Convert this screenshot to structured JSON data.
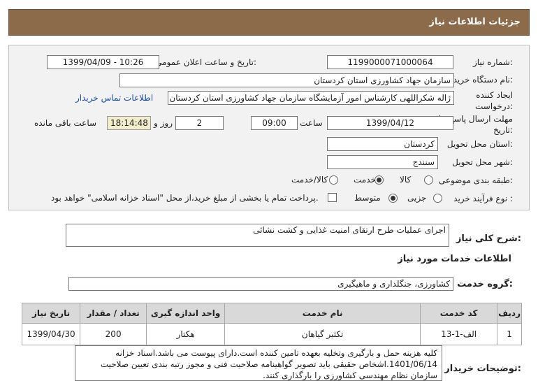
{
  "header": {
    "title": "جزئیات اطلاعات نیاز"
  },
  "form": {
    "need_number_label": "شماره نیاز:",
    "need_number": "1199000071000064",
    "announce_label": "تاریخ و ساعت اعلان عمومی:",
    "announce_value": "1399/04/09 - 10:26",
    "buyer_org_label": "نام دستگاه خریدار:",
    "buyer_org": "سازمان جهاد کشاورزی استان کردستان",
    "creator_label": "ایجاد کننده درخواست:",
    "creator": "ژاله شکراللهی کارشناس امور آزمایشگاه سازمان جهاد کشاورزی استان کردستان",
    "contact_link": "اطلاعات تماس خریدار",
    "deadline_label": "مهلت ارسال پاسخ: تا تاریخ:",
    "deadline_date": "1399/04/12",
    "time_label": "ساعت",
    "deadline_time": "09:00",
    "days_value": "2",
    "days_label": "روز و",
    "remaining_time": "18:14:48",
    "remaining_label": "ساعت باقی مانده",
    "province_label": "استان محل تحویل:",
    "province": "کردستان",
    "city_label": "شهر محل تحویل:",
    "city": "سنندج",
    "category_label": "طبقه بندی موضوعی:",
    "category_options": [
      "کالا",
      "خدمت",
      "کالا/خدمت"
    ],
    "category_selected": "خدمت",
    "process_label": "نوع فرآیند خرید :",
    "process_options": [
      "جزیی",
      "متوسط"
    ],
    "process_selected": "متوسط",
    "payment_note": "پرداخت تمام یا بخشی از مبلغ خرید،از محل \"اسناد خزانه اسلامی\" خواهد بود."
  },
  "summary": {
    "label": "شرح کلی نیاز:",
    "text": "اجرای عملیات طرح ارتقای امنیت غذایی و کشت نشائی"
  },
  "services_section": {
    "title": "اطلاعات خدمات مورد نیاز"
  },
  "service_group": {
    "label": "گروه خدمت:",
    "value": "کشاورزی، جنگلداری و ماهیگیری"
  },
  "table": {
    "headers": [
      "ردیف",
      "کد خدمت",
      "نام خدمت",
      "واحد اندازه گیری",
      "تعداد / مقدار",
      "تاریخ نیاز"
    ],
    "rows": [
      [
        "1",
        "الف-1-13",
        "تکثیر گیاهان",
        "هکتار",
        "200",
        "1399/04/30"
      ]
    ]
  },
  "buyer_notes": {
    "label": "توضیحات خریدار:",
    "text": "کلیه هزینه حمل و بارگیری وتخلیه بعهده تامین کننده است.دارای پیوست می باشد.اسناد خزانه 1401/06/14.اشخاص حقیقی باید تصویر گواهینامه صلاحیت فنی و مجوز رتبه بندی تعیین صلاحیت سازمان نظام مهندسی کشاورزی را بارگذاری کنند."
  }
}
